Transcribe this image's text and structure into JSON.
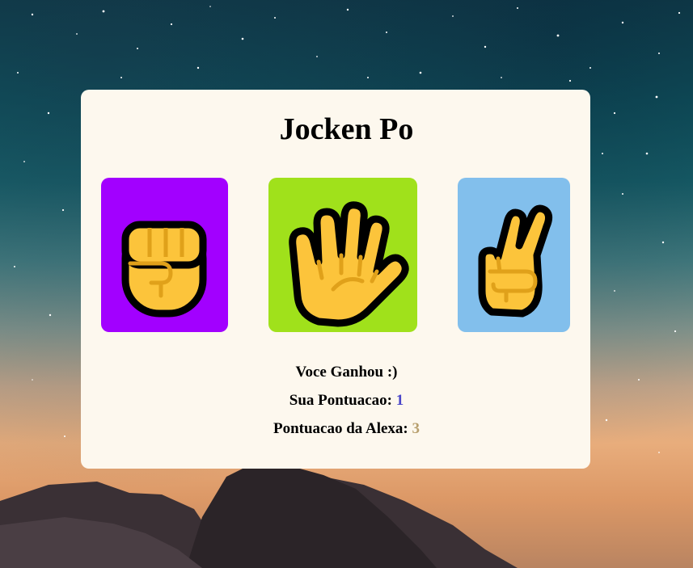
{
  "title": "Jocken Po",
  "choices": [
    {
      "name": "rock",
      "icon": "fist-icon",
      "color": "#a200ff"
    },
    {
      "name": "paper",
      "icon": "raised-hand-icon",
      "color": "#a0e11b"
    },
    {
      "name": "scissors",
      "icon": "victory-hand-icon",
      "color": "#82bfec"
    }
  ],
  "result": "Voce Ganhou :)",
  "score": {
    "player_label": "Sua Pontuacao:",
    "player_value": "1",
    "alexa_label": "Pontuacao da Alexa:",
    "alexa_value": "3"
  },
  "colors": {
    "card_background": "#fdf8ee",
    "player_score": "#4a46c9",
    "alexa_score": "#b8a06e",
    "hand_fill": "#fcc43b"
  }
}
